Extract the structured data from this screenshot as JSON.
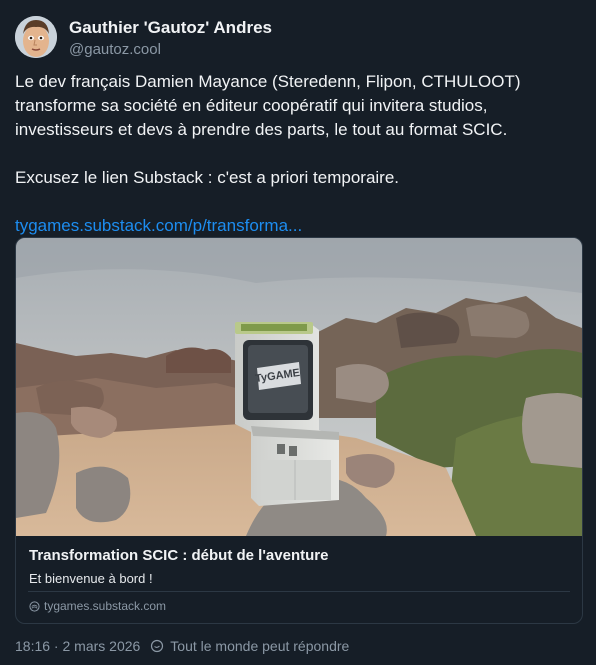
{
  "author": {
    "display_name": "Gauthier 'Gautoz' Andres",
    "handle": "@gautoz.cool"
  },
  "post": {
    "paragraph1": "Le dev français Damien Mayance (Steredenn, Flipon, CTHULOOT) transforme sa société en éditeur coopératif qui invitera studios, investisseurs et devs à prendre des parts, le tout au format SCIC.",
    "paragraph2": "Excusez le lien Substack : c'est a priori temporaire.",
    "link_text": "tygames.substack.com/p/transforma..."
  },
  "link_card": {
    "title": "Transformation SCIC : début de l'aventure",
    "description": "Et bienvenue à bord !",
    "domain": "tygames.substack.com",
    "arcade_screen_logo": "TyGAME"
  },
  "footer": {
    "timestamp": "18:16 · 2 mars 2026",
    "reply_setting": "Tout le monde peut répondre"
  },
  "colors": {
    "background": "#161e27",
    "link": "#1d8df0",
    "muted": "#8b98a5",
    "border": "#2c3844"
  },
  "icons": [
    "avatar",
    "globe-icon",
    "reply-permission-icon"
  ]
}
